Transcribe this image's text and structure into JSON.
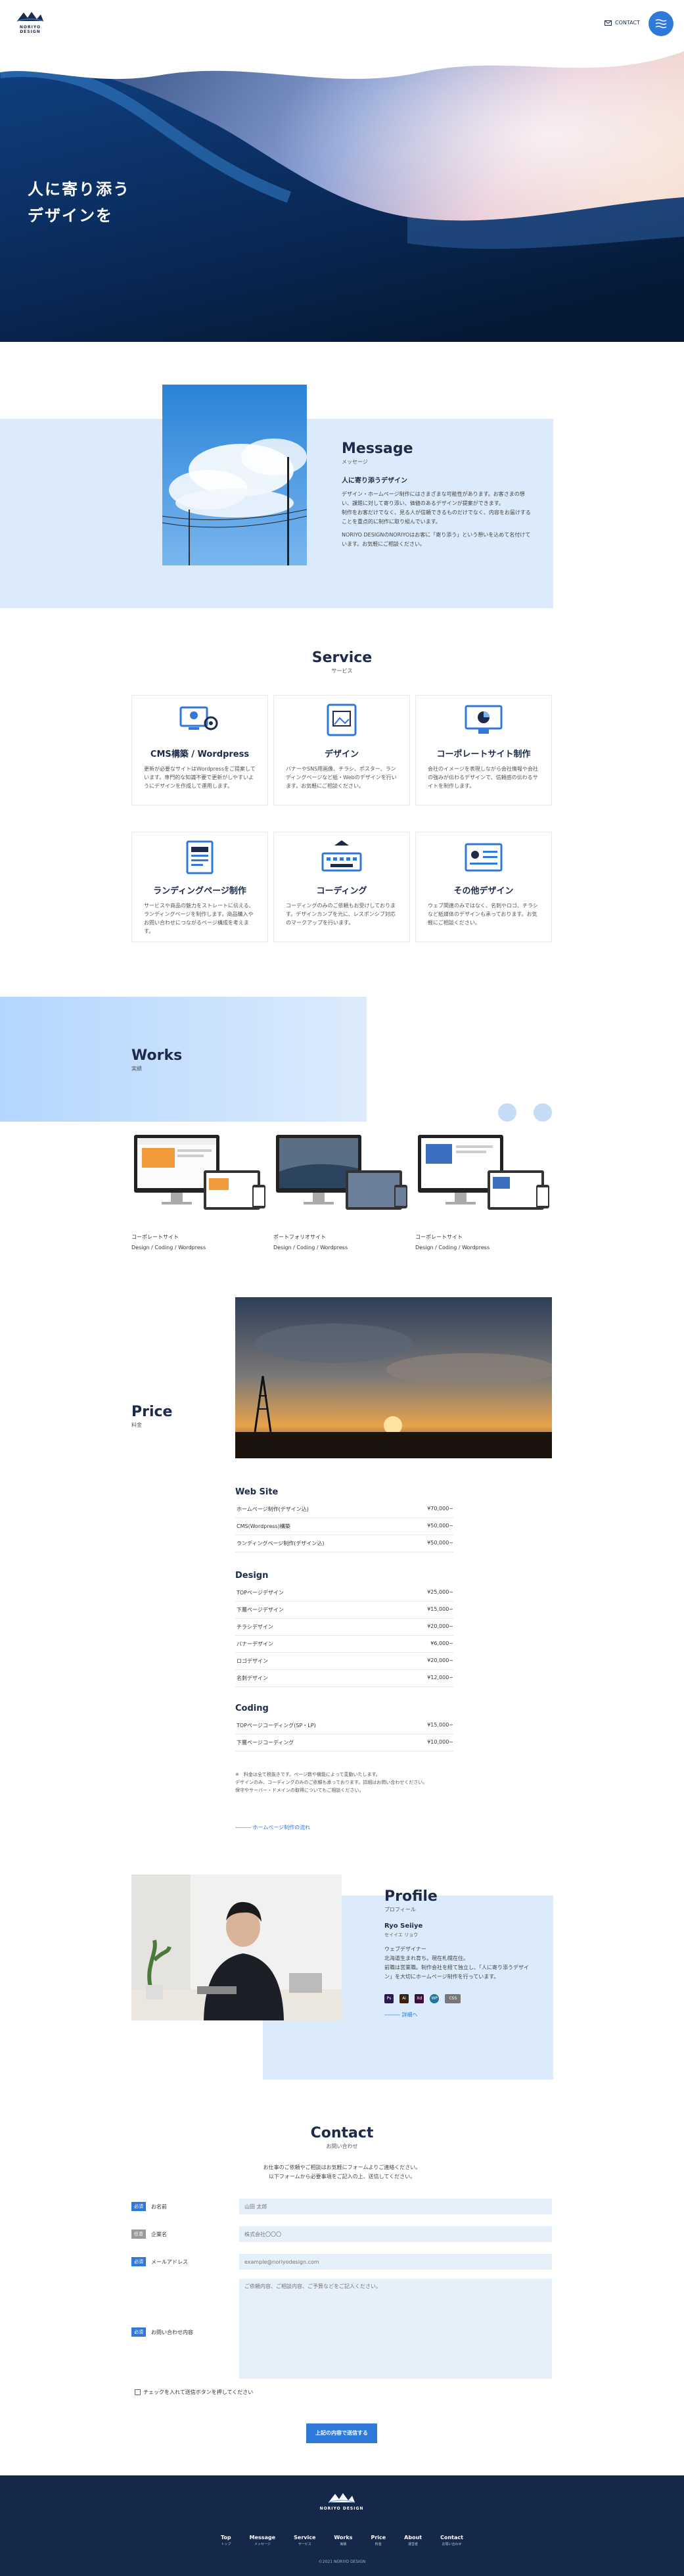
{
  "header": {
    "logo_text": "NORIYO DESIGN",
    "contact_label": "CONTACT"
  },
  "hero": {
    "line1": "人に寄り添う",
    "line2": "デザインを"
  },
  "message": {
    "title": "Message",
    "subtitle": "メッセージ",
    "heading": "人に寄り添うデザイン",
    "p1": "デザイン・ホームページ制作にはさまざまな可能性があります。お客さまの想い、課題に対して寄り添い、価値のあるデザインが提案ができます。",
    "p2": "制作をお客だけでなく、見る人が信頼できるものだけでなく、内容をお届けすることを重点的に制作に取り組んでいます。",
    "p3": "NORIYO DESIGNのNORIYOはお客に「寄り添う」という想いを込めて名付けています。お気軽にご相談ください。"
  },
  "service": {
    "title": "Service",
    "subtitle": "サービス",
    "items": [
      {
        "title": "CMS構築 / Wordpress",
        "desc": "更新が必要なサイトはWordpressをご提案しています。専門的な知識不要で更新がしやすいようにデザインを作成して運用します。"
      },
      {
        "title": "デザイン",
        "desc": "バナーやSNS用画像、チラシ、ポスター、ランディングページなど紙・Webのデザインを行います。お気軽にご相談ください。"
      },
      {
        "title": "コーポレートサイト制作",
        "desc": "会社のイメージを表現しながら会社情報や会社の強みが伝わるデザインで、信頼感の伝わるサイトを制作します。"
      },
      {
        "title": "ランディングページ制作",
        "desc": "サービスや商品の魅力をストレートに伝える、ランディングページを制作します。商品購入やお問い合わせにつながるページ構成を考えます。"
      },
      {
        "title": "コーディング",
        "desc": "コーディングのみのご依頼もお受けしております。デザインカンプを元に、レスポンシブ対応のマークアップを行います。"
      },
      {
        "title": "その他デザイン",
        "desc": "ウェブ関連のみではなく、名刺やロゴ、チラシなど紙媒体のデザインも承っております。お気軽にご相談ください。"
      }
    ]
  },
  "works": {
    "title": "Works",
    "subtitle": "実績",
    "items": [
      {
        "title": "コーポレートサイト",
        "tags": "Design / Coding / Wordpress"
      },
      {
        "title": "ポートフォリオサイト",
        "tags": "Design / Coding / Wordpress"
      },
      {
        "title": "コーポレートサイト",
        "tags": "Design / Coding / Wordpress"
      }
    ]
  },
  "price": {
    "title": "Price",
    "subtitle": "料金",
    "groups": [
      {
        "name": "Web Site",
        "rows": [
          {
            "item": "ホームページ制作(デザイン込)",
            "price": "¥70,000~"
          },
          {
            "item": "CMS(Wordpress)構築",
            "price": "¥50,000~"
          },
          {
            "item": "ランディングページ制作(デザイン込)",
            "price": "¥50,000~"
          }
        ]
      },
      {
        "name": "Design",
        "rows": [
          {
            "item": "TOPページデザイン",
            "price": "¥25,000~"
          },
          {
            "item": "下層ページデザイン",
            "price": "¥15,000~"
          },
          {
            "item": "チラシデザイン",
            "price": "¥20,000~"
          },
          {
            "item": "バナーデザイン",
            "price": "¥6,000~"
          },
          {
            "item": "ロゴデザイン",
            "price": "¥20,000~"
          },
          {
            "item": "名刺デザイン",
            "price": "¥12,000~"
          }
        ]
      },
      {
        "name": "Coding",
        "rows": [
          {
            "item": "TOPページコーディング(SP・LP)",
            "price": "¥15,000~"
          },
          {
            "item": "下層ページコーディング",
            "price": "¥10,000~"
          }
        ]
      }
    ],
    "note1": "※　料金は全て税抜きです。ページ数や機能によって変動いたします。",
    "note2": "デザインのみ、コーディングのみのご依頼も承っております。詳細はお問い合わせください。",
    "note3": "保守やサーバー・ドメインの取得についてもご相談ください。",
    "link": "ホームページ制作の流れ"
  },
  "profile": {
    "title": "Profile",
    "subtitle": "プロフィール",
    "name": "Ryo Seiiye",
    "role": "セイイエ リョウ",
    "p1": "ウェブデザイナー",
    "p2": "北海道生まれ育ち。現在札幌在住。",
    "p3": "前職は営業職。制作会社を経て独立し、「人に寄り添うデザイン」を大切にホームページ制作を行っています。",
    "tools": [
      "Ps",
      "Ai",
      "Xd",
      "WP",
      "CSS"
    ],
    "link": "詳細へ"
  },
  "contact": {
    "title": "Contact",
    "subtitle": "お問い合わせ",
    "intro1": "お仕事のご依頼やご相談はお気軽にフォームよりご連絡ください。",
    "intro2": "以下フォームから必要事項をご記入の上、送信してください。",
    "required": "必須",
    "optional": "任意",
    "fields": [
      {
        "label": "お名前",
        "placeholder": "山田 太郎"
      },
      {
        "label": "企業名",
        "placeholder": "株式会社〇〇〇"
      },
      {
        "label": "メールアドレス",
        "placeholder": "example@noriyodesign.com"
      },
      {
        "label": "お問い合わせ内容",
        "placeholder": "ご依頼内容、ご相談内容、ご予算などをご記入ください。"
      }
    ],
    "consent": "チェックを入れて送信ボタンを押してください",
    "submit": "上記の内容で送信する"
  },
  "footer": {
    "logo_text": "NORIYO DESIGN",
    "nav": [
      {
        "label": "Top",
        "sub": "トップ"
      },
      {
        "label": "Message",
        "sub": "メッセージ"
      },
      {
        "label": "Service",
        "sub": "サービス"
      },
      {
        "label": "Works",
        "sub": "実績"
      },
      {
        "label": "Price",
        "sub": "料金"
      },
      {
        "label": "About",
        "sub": "運営者"
      },
      {
        "label": "Contact",
        "sub": "お問い合わせ"
      }
    ],
    "copyright": "©2021 NORIYO DESIGN"
  },
  "colors": {
    "accent": "#2f7ad9",
    "navy": "#16284a",
    "light_blue": "#dcebfb"
  }
}
